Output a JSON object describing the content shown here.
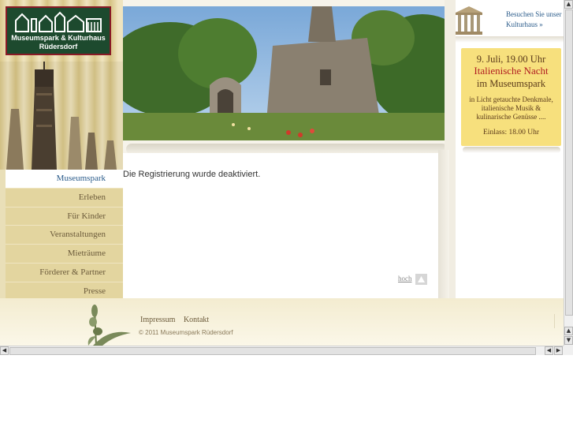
{
  "logo": {
    "line1": "Museumspark & Kulturhaus",
    "line2": "Rüdersdorf"
  },
  "nav": {
    "items": [
      {
        "label": "Museumspark",
        "active": true
      },
      {
        "label": "Erleben"
      },
      {
        "label": "Für Kinder"
      },
      {
        "label": "Veranstaltungen"
      },
      {
        "label": "Mieträume"
      },
      {
        "label": "Förderer & Partner"
      },
      {
        "label": "Presse"
      }
    ]
  },
  "content": {
    "message": "Die Registrierung wurde deaktiviert.",
    "top_link": "hoch"
  },
  "sidebar": {
    "visit_link": "Besuchen Sie unser Kulturhaus »",
    "event": {
      "date": "9. Juli, 19.00 Uhr",
      "title": "Italienische Nacht",
      "place": "im Museumspark",
      "description": "in Licht getauchte Denkmale, italienische Musik & kulinarische Genüsse ....",
      "entry": "Einlass: 18.00 Uhr"
    }
  },
  "footer": {
    "links": [
      "Impressum",
      "Kontakt"
    ],
    "copyright": "© 2011 Museumspark Rüdersdorf"
  },
  "colors": {
    "nav_active": "#2a5b8a",
    "event_title": "#b01d21",
    "logo_bg": "#1d4a2e",
    "logo_border": "#8a1a26"
  }
}
